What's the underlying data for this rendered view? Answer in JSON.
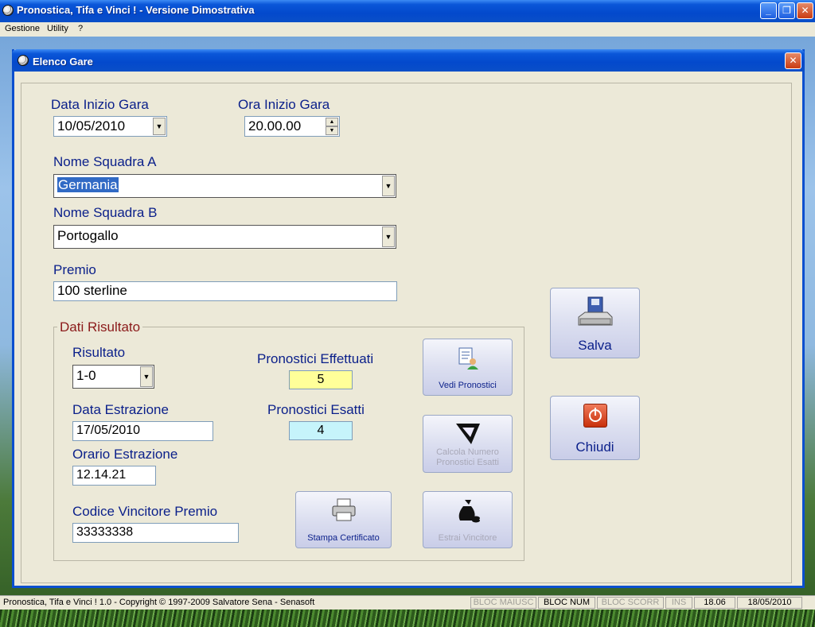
{
  "app": {
    "title": "Pronostica, Tifa e Vinci ! - Versione Dimostrativa"
  },
  "menu": {
    "items": [
      "Gestione",
      "Utility",
      "?"
    ]
  },
  "window": {
    "title": "Elenco Gare"
  },
  "form": {
    "data_inizio_label": "Data Inizio Gara",
    "data_inizio_value": "10/05/2010",
    "ora_inizio_label": "Ora Inizio Gara",
    "ora_inizio_value": "20.00.00",
    "squadra_a_label": "Nome Squadra A",
    "squadra_a_value": "Germania",
    "squadra_b_label": "Nome Squadra B",
    "squadra_b_value": "Portogallo",
    "premio_label": "Premio",
    "premio_value": "100 sterline"
  },
  "risultato": {
    "group_title": "Dati Risultato",
    "risultato_label": "Risultato",
    "risultato_value": "1-0",
    "data_estrazione_label": "Data Estrazione",
    "data_estrazione_value": "17/05/2010",
    "orario_estrazione_label": "Orario Estrazione",
    "orario_estrazione_value": "12.14.21",
    "codice_vincitore_label": "Codice Vincitore Premio",
    "codice_vincitore_value": "33333338",
    "pronostici_effettuati_label": "Pronostici Effettuati",
    "pronostici_effettuati_value": "5",
    "pronostici_esatti_label": "Pronostici Esatti",
    "pronostici_esatti_value": "4",
    "vedi_label": "Vedi Pronostici",
    "calcola_label_1": "Calcola Numero",
    "calcola_label_2": "Pronostici Esatti",
    "stampa_label": "Stampa Certificato",
    "estrai_label": "Estrai Vincitore"
  },
  "actions": {
    "salva_label": "Salva",
    "chiudi_label": "Chiudi"
  },
  "statusbar": {
    "text": "Pronostica, Tifa e Vinci ! 1.0 - Copyright © 1997-2009 Salvatore Sena - Senasoft",
    "caps": "BLOC MAIUSC",
    "num": "BLOC NUM",
    "scroll": "BLOC SCORR",
    "ins": "INS",
    "time": "18.06",
    "date": "18/05/2010"
  },
  "colors": {
    "titlebar": "#0a56d8",
    "field_yellow": "#ffff99",
    "field_cyan": "#c6f4fb",
    "label": "#0a1f8a",
    "group_title": "#8b1a1a"
  }
}
